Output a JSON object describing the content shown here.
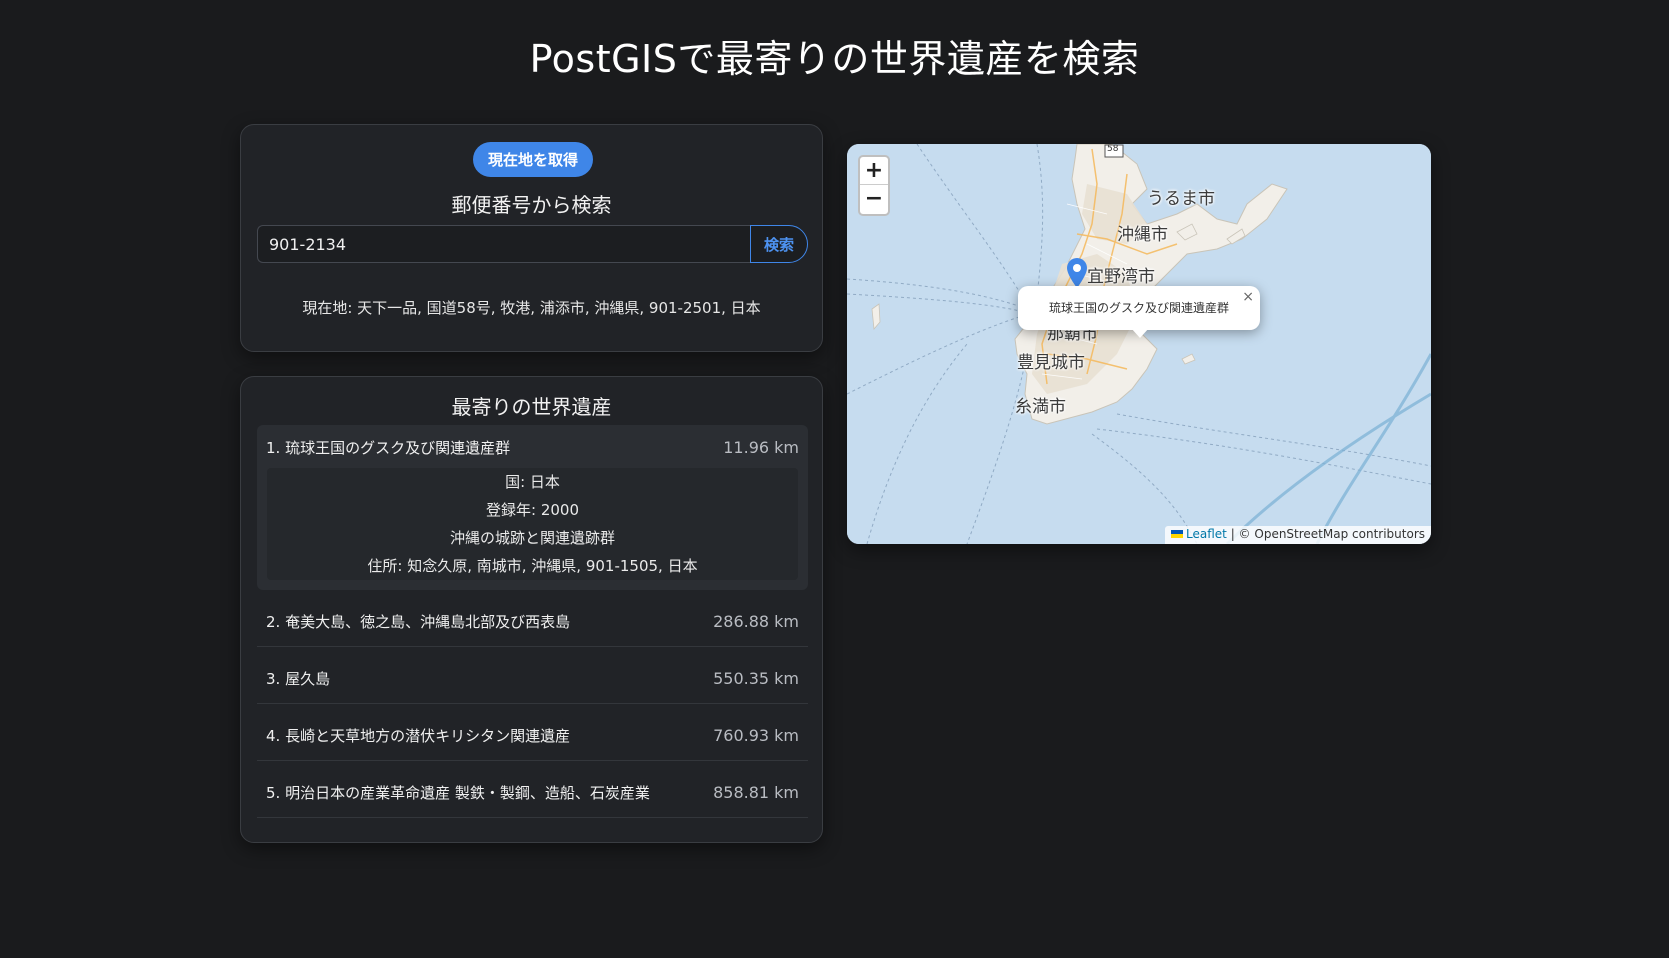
{
  "page": {
    "title": "PostGISで最寄りの世界遺産を検索"
  },
  "search": {
    "locate_button": "現在地を取得",
    "heading": "郵便番号から検索",
    "zip_value": "901-2134",
    "search_button": "検索",
    "current_location": "現在地: 天下一品, 国道58号, 牧港, 浦添市, 沖縄県, 901-2501, 日本"
  },
  "results": {
    "heading": "最寄りの世界遺産",
    "items": [
      {
        "name": "1. 琉球王国のグスク及び関連遺産群",
        "distance": "11.96 km",
        "details": {
          "country": "国: 日本",
          "year": "登録年: 2000",
          "description": "沖縄の城跡と関連遺跡群",
          "address": "住所: 知念久原, 南城市, 沖縄県, 901-1505, 日本"
        }
      },
      {
        "name": "2. 奄美大島、徳之島、沖縄島北部及び西表島",
        "distance": "286.88 km"
      },
      {
        "name": "3. 屋久島",
        "distance": "550.35 km"
      },
      {
        "name": "4. 長崎と天草地方の潜伏キリシタン関連遺産",
        "distance": "760.93 km"
      },
      {
        "name": "5. 明治日本の産業革命遺産 製鉄・製鋼、造船、石炭産業",
        "distance": "858.81 km"
      }
    ]
  },
  "map": {
    "zoom_in": "+",
    "zoom_out": "−",
    "route_shield": "58",
    "labels": {
      "uruma": "うるま市",
      "okinawa": "沖縄市",
      "ginowan": "宜野湾市",
      "naha": "那覇市",
      "tomigusuku": "豊見城市",
      "itoman": "糸満市"
    },
    "popup_text": "琉球王国のグスク及び関連遺産群",
    "popup_close": "×",
    "attribution_link": "Leaflet",
    "attribution_text": "| © OpenStreetMap contributors",
    "colors": {
      "water": "#c6dcef",
      "land": "#f2efe9",
      "marker": "#3f86e8"
    }
  },
  "theme": {
    "background": "#1a1b1d",
    "panel": "#212327",
    "accent": "#3f86e8"
  }
}
